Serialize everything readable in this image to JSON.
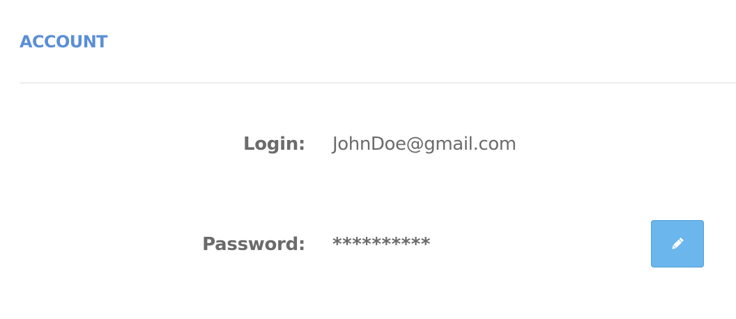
{
  "header": {
    "title": "ACCOUNT"
  },
  "account": {
    "login_label": "Login:",
    "login_value": "JohnDoe@gmail.com",
    "password_label": "Password:",
    "password_value": "**********",
    "edit_button_icon": "pencil-icon"
  },
  "colors": {
    "title": "#5b8fd6",
    "text": "#6b6b6b",
    "button_bg": "#6bb6ec",
    "button_border": "#4f9fd9",
    "divider": "#ececec"
  }
}
